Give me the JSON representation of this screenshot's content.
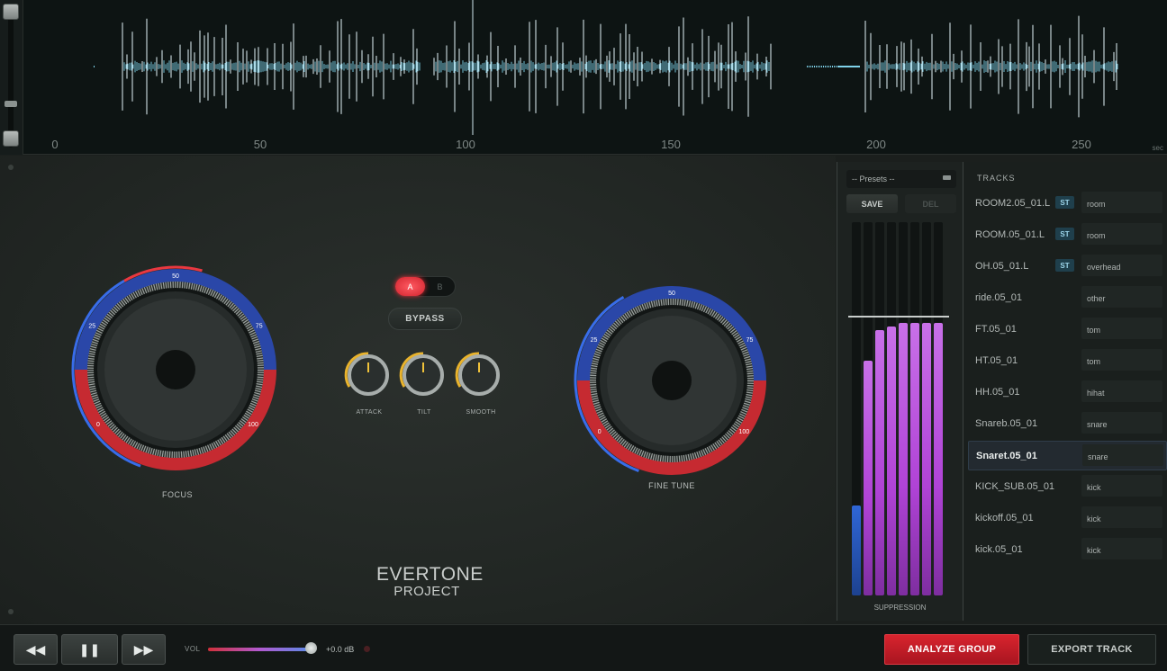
{
  "waveform": {
    "axis_ticks": [
      "0",
      "50",
      "100",
      "150",
      "200",
      "250"
    ],
    "unit": "sec",
    "accent_color": "#7fd2ea"
  },
  "dials": {
    "focus": {
      "label": "FOCUS",
      "marks": [
        "0",
        "25",
        "50",
        "75",
        "100"
      ]
    },
    "fine_tune": {
      "label": "FINE TUNE",
      "marks": [
        "0",
        "25",
        "50",
        "75",
        "100"
      ]
    }
  },
  "ab_switch": {
    "a": "A",
    "b": "B",
    "selected": "A"
  },
  "bypass_label": "BYPASS",
  "small_knobs": [
    {
      "label": "ATTACK"
    },
    {
      "label": "TILT"
    },
    {
      "label": "SMOOTH"
    }
  ],
  "logo": {
    "line1": "EVERTONE",
    "line2": "PROJECT"
  },
  "presets": {
    "placeholder": "-- Presets --",
    "save": "SAVE",
    "del": "DEL"
  },
  "meter": {
    "title": "SUPPRESSION",
    "levels": [
      0.24,
      0.63,
      0.71,
      0.72,
      0.73,
      0.73,
      0.73,
      0.73
    ],
    "threshold": 0.74,
    "colors": {
      "input": "#2f66d6",
      "bars": "#b043d6"
    }
  },
  "tracks": {
    "title": "TRACKS",
    "selected_index": 8,
    "items": [
      {
        "name": "ROOM2.05_01.L",
        "badge": "ST",
        "category": "room"
      },
      {
        "name": "ROOM.05_01.L",
        "badge": "ST",
        "category": "room"
      },
      {
        "name": "OH.05_01.L",
        "badge": "ST",
        "category": "overhead"
      },
      {
        "name": "ride.05_01",
        "badge": "",
        "category": "other"
      },
      {
        "name": "FT.05_01",
        "badge": "",
        "category": "tom"
      },
      {
        "name": "HT.05_01",
        "badge": "",
        "category": "tom"
      },
      {
        "name": "HH.05_01",
        "badge": "",
        "category": "hihat"
      },
      {
        "name": "Snareb.05_01",
        "badge": "",
        "category": "snare"
      },
      {
        "name": "Snaret.05_01",
        "badge": "",
        "category": "snare"
      },
      {
        "name": "KICK_SUB.05_01",
        "badge": "",
        "category": "kick"
      },
      {
        "name": "kickoff.05_01",
        "badge": "",
        "category": "kick"
      },
      {
        "name": "kick.05_01",
        "badge": "",
        "category": "kick"
      }
    ]
  },
  "transport": {
    "rewind_icon": "◀◀",
    "pause_icon": "❚❚",
    "forward_icon": "▶▶",
    "vol_label": "VOL",
    "vol_db": "+0.0 dB",
    "vol_level": 0.95
  },
  "actions": {
    "analyze": "ANALYZE GROUP",
    "export": "EXPORT TRACK"
  }
}
